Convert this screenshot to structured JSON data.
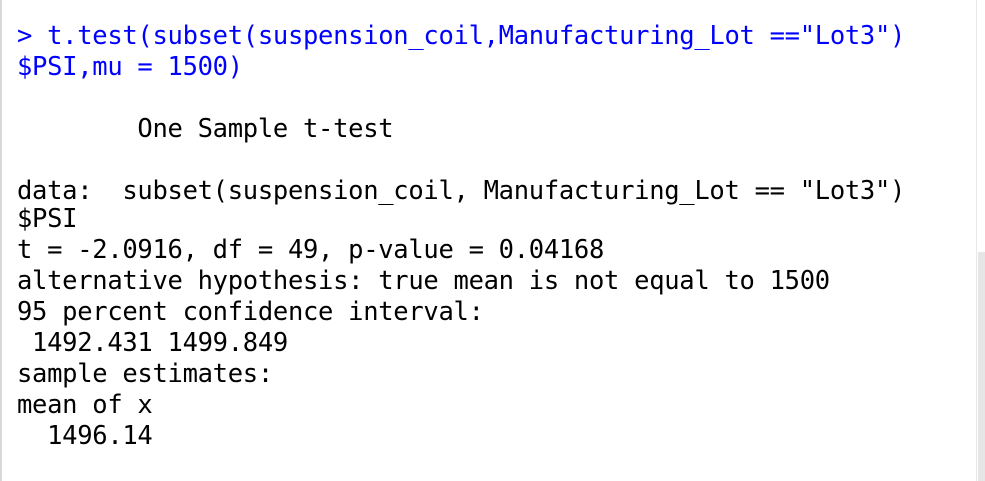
{
  "console": {
    "command_line1": "> t.test(subset(suspension_coil,Manufacturing_Lot ==\"Lot3\")",
    "command_line2": "$PSI,mu = 1500)",
    "test_title": "        One Sample t-test",
    "data_line1": "data:  subset(suspension_coil, Manufacturing_Lot == \"Lot3\")",
    "data_line2": "$PSI",
    "stats_line": "t = -2.0916, df = 49, p-value = 0.04168",
    "alt_hypothesis": "alternative hypothesis: true mean is not equal to 1500",
    "ci_label": "95 percent confidence interval:",
    "ci_values": " 1492.431 1499.849",
    "estimates_label": "sample estimates:",
    "estimate_name": "mean of x",
    "estimate_value": "  1496.14"
  },
  "colors": {
    "command": "#0000ff",
    "output": "#000000",
    "background": "#ffffff"
  }
}
